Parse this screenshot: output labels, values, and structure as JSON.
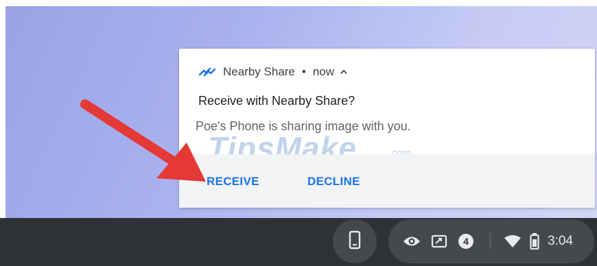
{
  "notification": {
    "app_name": "Nearby Share",
    "separator": "•",
    "time": "now",
    "title": "Receive with Nearby Share?",
    "message": "Poe's Phone is sharing image with you.",
    "actions": {
      "receive": "RECEIVE",
      "decline": "DECLINE"
    },
    "accent_color": "#1a73e8",
    "icons": {
      "app": "nearby-share-icon",
      "expand": "chevron-up-icon"
    }
  },
  "watermark": {
    "text": "TipsMake",
    "suffix": ".com"
  },
  "shelf": {
    "phone_hub_icon": "phone-icon",
    "tray": {
      "icons": [
        "eye-icon",
        "screen-share-icon"
      ],
      "notification_count": "4",
      "status_icons": [
        "wifi-icon",
        "battery-icon"
      ],
      "time": "3:04"
    }
  },
  "annotation": {
    "arrow_color": "#e53935"
  }
}
